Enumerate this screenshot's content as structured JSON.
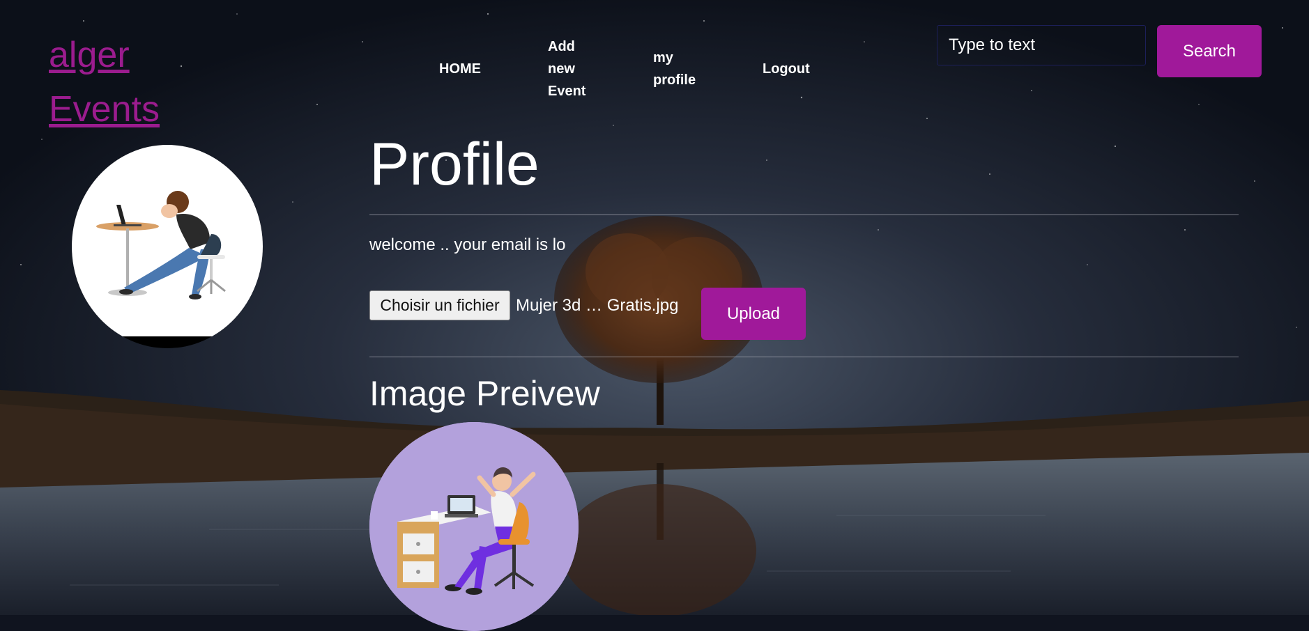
{
  "brand": {
    "line1": "alger",
    "line2": "Events",
    "color": "#9b1c8e"
  },
  "nav": {
    "home": "HOME",
    "add_event": "Add new Event",
    "my_profile": "my profile",
    "logout": "Logout"
  },
  "search": {
    "placeholder": "Type to text",
    "button_label": "Search"
  },
  "main": {
    "title": "Profile",
    "welcome_text": "welcome .. your email is lo",
    "file_button_label": "Choisir un fichier",
    "file_name": "Mujer 3d … Gratis.jpg",
    "upload_label": "Upload",
    "preview_title": "Image Preivew"
  },
  "colors": {
    "accent": "#a0199a",
    "text": "#ffffff",
    "background": "#10141f"
  },
  "icons": {
    "avatar": "woman-at-desk-illustration",
    "preview": "woman-stretching-at-desk-illustration"
  }
}
